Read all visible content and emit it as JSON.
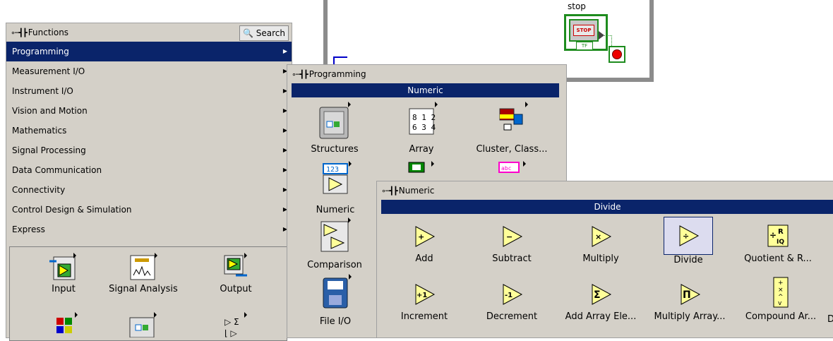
{
  "block_diagram": {
    "stop_caption": "stop",
    "stop_button_text": "STOP",
    "tf_text": "TF"
  },
  "functions_palette": {
    "title": "Functions",
    "search_label": "Search",
    "categories": [
      {
        "label": "Programming",
        "selected": true
      },
      {
        "label": "Measurement I/O"
      },
      {
        "label": "Instrument I/O"
      },
      {
        "label": "Vision and Motion"
      },
      {
        "label": "Mathematics"
      },
      {
        "label": "Signal Processing"
      },
      {
        "label": "Data Communication"
      },
      {
        "label": "Connectivity"
      },
      {
        "label": "Control Design & Simulation"
      },
      {
        "label": "Express"
      }
    ],
    "express_items": [
      "Input",
      "Signal Analysis",
      "Output"
    ]
  },
  "programming_palette": {
    "title": "Programming",
    "selected_label": "Numeric",
    "items": [
      "Structures",
      "Array",
      "Cluster, Class...",
      "Numeric",
      "Comparison",
      "File I/O"
    ]
  },
  "numeric_palette": {
    "title": "Numeric",
    "selected_label": "Divide",
    "row1": [
      "Add",
      "Subtract",
      "Multiply",
      "Divide",
      "Quotient & R..."
    ],
    "row2": [
      "Increment",
      "Decrement",
      "Add Array Ele...",
      "Multiply Array...",
      "Compound Ar...",
      "D"
    ]
  },
  "colors": {
    "selection": "#0a246a",
    "palette_bg": "#d4d0c8",
    "terminal_green": "#1e8c1e"
  }
}
